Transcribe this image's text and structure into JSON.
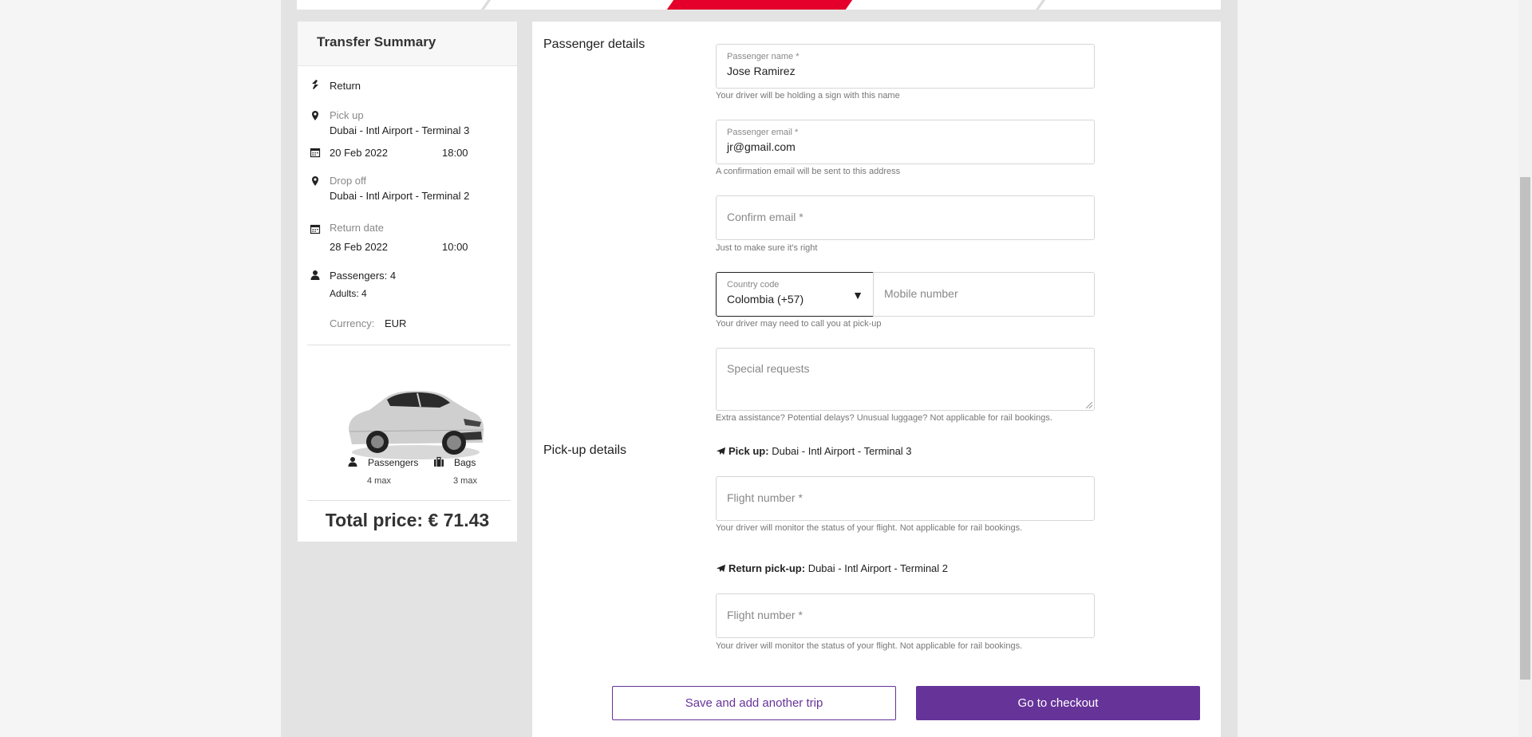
{
  "summary": {
    "title": "Transfer Summary",
    "trip_type": "Return",
    "pickup_label": "Pick up",
    "pickup_location": "Dubai - Intl Airport - Terminal 3",
    "pickup_date": "20 Feb 2022",
    "pickup_time": "18:00",
    "dropoff_label": "Drop off",
    "dropoff_location": "Dubai - Intl Airport - Terminal 2",
    "return_label": "Return date",
    "return_date": "28 Feb 2022",
    "return_time": "10:00",
    "passengers": "Passengers: 4",
    "adults": "Adults: 4",
    "currency_label": "Currency:",
    "currency_value": "EUR",
    "vehicle": {
      "passengers_label": "Passengers",
      "passengers_max": "4 max",
      "bags_label": "Bags",
      "bags_max": "3 max"
    },
    "total_price": "Total price: € 71.43"
  },
  "passenger": {
    "section_title": "Passenger details",
    "name_label": "Passenger name *",
    "name_value": "Jose Ramirez",
    "name_hint": "Your driver will be holding a sign with this name",
    "email_label": "Passenger email *",
    "email_value": "jr@gmail.com",
    "email_hint": "A confirmation email will be sent to this address",
    "confirm_placeholder": "Confirm email *",
    "confirm_hint": "Just to make sure it's right",
    "country_label": "Country code",
    "country_value": "Colombia (+57)",
    "mobile_placeholder": "Mobile number",
    "phone_hint": "Your driver may need to call you at pick-up",
    "requests_placeholder": "Special requests",
    "requests_hint": "Extra assistance? Potential delays? Unusual luggage? Not applicable for rail bookings."
  },
  "pickup": {
    "section_title": "Pick-up details",
    "pickup_label": "Pick up:",
    "pickup_value": "Dubai - Intl Airport - Terminal 3",
    "flight_placeholder": "Flight number *",
    "flight_hint": "Your driver will monitor the status of your flight. Not applicable for rail bookings.",
    "return_label": "Return pick-up:",
    "return_value": "Dubai - Intl Airport - Terminal 2",
    "return_flight_placeholder": "Flight number *",
    "return_flight_hint": "Your driver will monitor the status of your flight. Not applicable for rail bookings."
  },
  "actions": {
    "save_label": "Save and add another trip",
    "checkout_label": "Go to checkout"
  },
  "colors": {
    "accent": "#663399",
    "progress_active": "#e4002b"
  }
}
